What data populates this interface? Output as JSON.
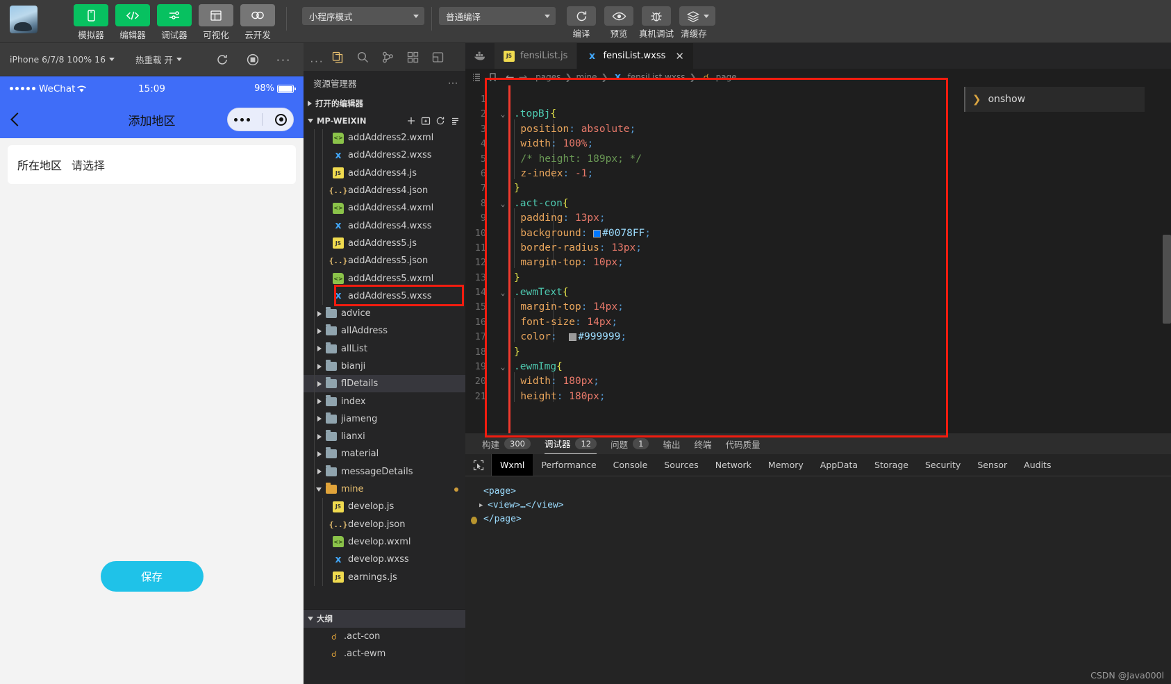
{
  "toolbar": {
    "modes": [
      {
        "icon": "phone-icon",
        "label": "模拟器",
        "style": "green"
      },
      {
        "icon": "code-icon",
        "label": "编辑器",
        "style": "green"
      },
      {
        "icon": "debugger-icon",
        "label": "调试器",
        "style": "green"
      },
      {
        "icon": "layout-icon",
        "label": "可视化",
        "style": "gray"
      },
      {
        "icon": "cloud-icon",
        "label": "云开发",
        "style": "gray"
      }
    ],
    "mode_select": "小程序模式",
    "compile_select": "普通编译",
    "actions": [
      {
        "icon": "refresh-icon",
        "label": "编译"
      },
      {
        "icon": "eye-icon",
        "label": "预览"
      },
      {
        "icon": "bug-icon",
        "label": "真机调试"
      },
      {
        "icon": "layers-icon",
        "label": "清缓存"
      }
    ]
  },
  "simbar": {
    "device": "iPhone 6/7/8 100% 16",
    "hotreload": "热重载 开",
    "icons": [
      "refresh-icon",
      "record-icon",
      "more-icon"
    ]
  },
  "simulator": {
    "status": {
      "carrier": "WeChat",
      "time": "15:09",
      "battery": "98%"
    },
    "nav_title": "添加地区",
    "form": {
      "label": "所在地区",
      "placeholder": "请选择"
    },
    "save_label": "保存"
  },
  "explorer": {
    "icons": [
      "files-icon",
      "search-icon",
      "source-control-icon",
      "extensions-icon",
      "debug-icon"
    ],
    "title": "资源管理器",
    "open_editors": "打开的编辑器",
    "project": "MP-WEIXIN",
    "project_actions": [
      "new-file-icon",
      "new-folder-icon",
      "refresh-icon",
      "collapse-icon"
    ],
    "tree": [
      {
        "name": "addAddress2.wxml",
        "kind": "wxml",
        "depth": 3
      },
      {
        "name": "addAddress2.wxss",
        "kind": "wxss",
        "depth": 3
      },
      {
        "name": "addAddress4.js",
        "kind": "js",
        "depth": 3
      },
      {
        "name": "addAddress4.json",
        "kind": "json",
        "depth": 3
      },
      {
        "name": "addAddress4.wxml",
        "kind": "wxml",
        "depth": 3
      },
      {
        "name": "addAddress4.wxss",
        "kind": "wxss",
        "depth": 3
      },
      {
        "name": "addAddress5.js",
        "kind": "js",
        "depth": 3
      },
      {
        "name": "addAddress5.json",
        "kind": "json",
        "depth": 3
      },
      {
        "name": "addAddress5.wxml",
        "kind": "wxml",
        "depth": 3
      },
      {
        "name": "addAddress5.wxss",
        "kind": "wxss",
        "depth": 3,
        "highlight": true
      },
      {
        "name": "advice",
        "kind": "folder",
        "depth": 2
      },
      {
        "name": "allAddress",
        "kind": "folder",
        "depth": 2
      },
      {
        "name": "allList",
        "kind": "folder",
        "depth": 2
      },
      {
        "name": "bianji",
        "kind": "folder",
        "depth": 2
      },
      {
        "name": "flDetails",
        "kind": "folder",
        "depth": 2,
        "selected": true
      },
      {
        "name": "index",
        "kind": "folder",
        "depth": 2
      },
      {
        "name": "jiameng",
        "kind": "folder",
        "depth": 2
      },
      {
        "name": "lianxi",
        "kind": "folder",
        "depth": 2
      },
      {
        "name": "material",
        "kind": "folder",
        "depth": 2
      },
      {
        "name": "messageDetails",
        "kind": "folder",
        "depth": 2
      },
      {
        "name": "mine",
        "kind": "folder-open",
        "depth": 2,
        "modified": true
      },
      {
        "name": "develop.js",
        "kind": "js",
        "depth": 3
      },
      {
        "name": "develop.json",
        "kind": "json",
        "depth": 3
      },
      {
        "name": "develop.wxml",
        "kind": "wxml",
        "depth": 3
      },
      {
        "name": "develop.wxss",
        "kind": "wxss",
        "depth": 3
      },
      {
        "name": "earnings.js",
        "kind": "js",
        "depth": 3
      }
    ],
    "outline_title": "大纲",
    "outline": [
      {
        "name": ".act-con",
        "icon": "css-symbol-icon"
      },
      {
        "name": ".act-ewm",
        "icon": "css-symbol-icon"
      }
    ]
  },
  "editor": {
    "tabs": [
      {
        "label": "fensiList.js",
        "kind": "js",
        "active": false,
        "closable": false
      },
      {
        "label": "fensiList.wxss",
        "kind": "wxss",
        "active": true,
        "closable": true
      }
    ],
    "breadcrumb": [
      "pages",
      "mine",
      "fensiList.wxss",
      "page"
    ],
    "breadcrumb_icons": [
      "list-icon",
      "bookmark-icon",
      "back-arrow-icon",
      "forward-arrow-icon"
    ],
    "lines": [
      {
        "n": 1,
        "fold": "",
        "tokens": []
      },
      {
        "n": 2,
        "fold": "v",
        "tokens": [
          {
            "t": ".topBj",
            "c": "k-sel"
          },
          {
            "t": "{",
            "c": "k-brace"
          }
        ]
      },
      {
        "n": 3,
        "fold": "",
        "indent": 2,
        "tokens": [
          {
            "t": "position",
            "c": "k-prop"
          },
          {
            "t": ":",
            "c": "k-col"
          },
          {
            "t": " absolute",
            "c": "k-val"
          },
          {
            "t": ";",
            "c": "k-col"
          }
        ]
      },
      {
        "n": 4,
        "fold": "",
        "indent": 2,
        "tokens": [
          {
            "t": "width",
            "c": "k-prop"
          },
          {
            "t": ":",
            "c": "k-col"
          },
          {
            "t": " 100%",
            "c": "k-num"
          },
          {
            "t": ";",
            "c": "k-col"
          }
        ]
      },
      {
        "n": 5,
        "fold": "",
        "indent": 2,
        "tokens": [
          {
            "t": "/* height: 189px; */",
            "c": "k-com"
          }
        ]
      },
      {
        "n": 6,
        "fold": "",
        "indent": 2,
        "tokens": [
          {
            "t": "z-index",
            "c": "k-prop"
          },
          {
            "t": ":",
            "c": "k-col"
          },
          {
            "t": " -1",
            "c": "k-num"
          },
          {
            "t": ";",
            "c": "k-col"
          }
        ]
      },
      {
        "n": 7,
        "fold": "",
        "indent": 0,
        "tokens": [
          {
            "t": "}",
            "c": "k-brace"
          }
        ]
      },
      {
        "n": 8,
        "fold": "v",
        "tokens": [
          {
            "t": ".act-con",
            "c": "k-sel"
          },
          {
            "t": "{",
            "c": "k-brace"
          }
        ]
      },
      {
        "n": 9,
        "fold": "",
        "indent": 2,
        "tokens": [
          {
            "t": "padding",
            "c": "k-prop"
          },
          {
            "t": ":",
            "c": "k-col"
          },
          {
            "t": " 13px",
            "c": "k-num"
          },
          {
            "t": ";",
            "c": "k-col"
          }
        ]
      },
      {
        "n": 10,
        "fold": "",
        "indent": 2,
        "tokens": [
          {
            "t": "background",
            "c": "k-prop"
          },
          {
            "t": ":",
            "c": "k-col"
          },
          {
            "t": " ",
            "c": "k-punc"
          },
          {
            "t": "#0078FF",
            "c": "k-hex",
            "swatch": "#0078FF"
          },
          {
            "t": ";",
            "c": "k-col"
          }
        ]
      },
      {
        "n": 11,
        "fold": "",
        "indent": 2,
        "tokens": [
          {
            "t": "border-radius",
            "c": "k-prop"
          },
          {
            "t": ":",
            "c": "k-col"
          },
          {
            "t": " 13px",
            "c": "k-num"
          },
          {
            "t": ";",
            "c": "k-col"
          }
        ]
      },
      {
        "n": 12,
        "fold": "",
        "indent": 2,
        "tokens": [
          {
            "t": "margin-top",
            "c": "k-prop"
          },
          {
            "t": ":",
            "c": "k-col"
          },
          {
            "t": " 10px",
            "c": "k-num"
          },
          {
            "t": ";",
            "c": "k-col"
          }
        ]
      },
      {
        "n": 13,
        "fold": "",
        "indent": 0,
        "tokens": [
          {
            "t": "}",
            "c": "k-brace"
          }
        ]
      },
      {
        "n": 14,
        "fold": "v",
        "tokens": [
          {
            "t": ".ewmText",
            "c": "k-sel"
          },
          {
            "t": "{",
            "c": "k-brace"
          }
        ]
      },
      {
        "n": 15,
        "fold": "",
        "indent": 2,
        "tokens": [
          {
            "t": "margin-top",
            "c": "k-prop"
          },
          {
            "t": ":",
            "c": "k-col"
          },
          {
            "t": " 14px",
            "c": "k-num"
          },
          {
            "t": ";",
            "c": "k-col"
          }
        ]
      },
      {
        "n": 16,
        "fold": "",
        "indent": 2,
        "tokens": [
          {
            "t": "font-size",
            "c": "k-prop"
          },
          {
            "t": ":",
            "c": "k-col"
          },
          {
            "t": " 14px",
            "c": "k-num"
          },
          {
            "t": ";",
            "c": "k-col"
          }
        ]
      },
      {
        "n": 17,
        "fold": "",
        "indent": 2,
        "tokens": [
          {
            "t": "color",
            "c": "k-prop"
          },
          {
            "t": ":",
            "c": "k-col"
          },
          {
            "t": "  ",
            "c": "k-punc"
          },
          {
            "t": "#999999",
            "c": "k-hex",
            "swatch": "#999999"
          },
          {
            "t": ";",
            "c": "k-col"
          }
        ]
      },
      {
        "n": 18,
        "fold": "",
        "indent": 0,
        "tokens": [
          {
            "t": "}",
            "c": "k-brace"
          }
        ]
      },
      {
        "n": 19,
        "fold": "v",
        "tokens": [
          {
            "t": ".ewmImg",
            "c": "k-sel"
          },
          {
            "t": "{",
            "c": "k-brace"
          }
        ]
      },
      {
        "n": 20,
        "fold": "",
        "indent": 2,
        "tokens": [
          {
            "t": "width",
            "c": "k-prop"
          },
          {
            "t": ":",
            "c": "k-col"
          },
          {
            "t": " 180px",
            "c": "k-num"
          },
          {
            "t": ";",
            "c": "k-col"
          }
        ]
      },
      {
        "n": 21,
        "fold": "",
        "indent": 2,
        "tokens": [
          {
            "t": "height",
            "c": "k-prop"
          },
          {
            "t": ":",
            "c": "k-col"
          },
          {
            "t": " 180px",
            "c": "k-num"
          },
          {
            "t": ";",
            "c": "k-col"
          }
        ]
      }
    ]
  },
  "onshow": {
    "label": "onshow",
    "chevron": "chevron-right-icon"
  },
  "problem_bar": [
    {
      "label": "构建",
      "badge": "300",
      "active": false
    },
    {
      "label": "调试器",
      "badge": "12",
      "active": true
    },
    {
      "label": "问题",
      "badge": "1",
      "active": false
    },
    {
      "label": "输出",
      "badge": "",
      "active": false
    },
    {
      "label": "终端",
      "badge": "",
      "active": false
    },
    {
      "label": "代码质量",
      "badge": "",
      "active": false
    }
  ],
  "devtools": {
    "cursor_icon": "inspect-icon",
    "tabs": [
      {
        "label": "Wxml",
        "active": true
      },
      {
        "label": "Performance",
        "active": false
      },
      {
        "label": "Console",
        "active": false
      },
      {
        "label": "Sources",
        "active": false
      },
      {
        "label": "Network",
        "active": false
      },
      {
        "label": "Memory",
        "active": false
      },
      {
        "label": "AppData",
        "active": false
      },
      {
        "label": "Storage",
        "active": false
      },
      {
        "label": "Security",
        "active": false
      },
      {
        "label": "Sensor",
        "active": false
      },
      {
        "label": "Audits",
        "active": false
      }
    ],
    "wxml": [
      {
        "text": "<page>",
        "expandable": false,
        "indent": 0
      },
      {
        "text": "<view>…</view>",
        "expandable": true,
        "indent": 1
      },
      {
        "text": "</page>",
        "expandable": false,
        "indent": 0
      }
    ]
  },
  "watermark": "CSDN @Java000l",
  "colors": {
    "accent_green": "#07c160",
    "wechat_blue": "#3f6df8",
    "highlight_red": "#f21c0f"
  }
}
